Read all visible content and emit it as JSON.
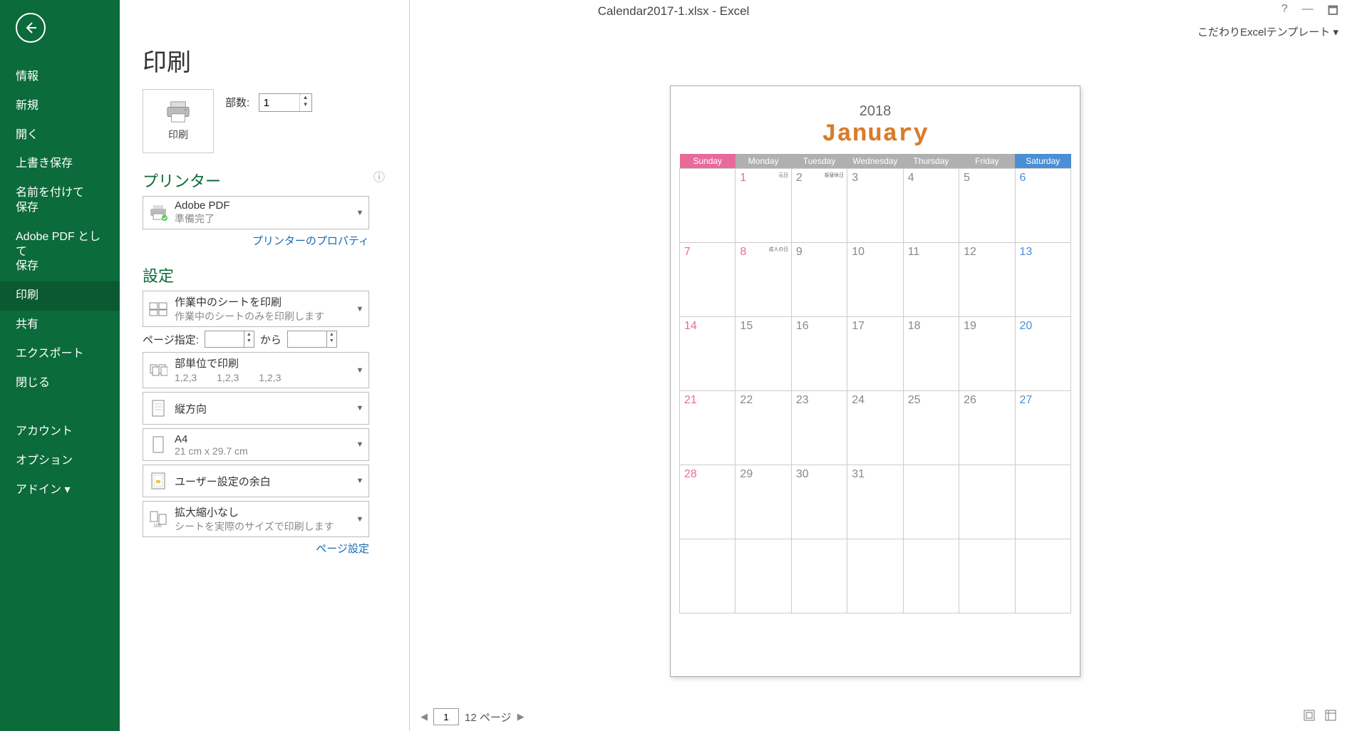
{
  "title": "Calendar2017-1.xlsx - Excel",
  "ribbon_right": "こだわりExcelテンプレート ▾",
  "winctrls": {
    "help": "?",
    "min": "—",
    "restore": "🗖"
  },
  "green_menu": {
    "items": [
      "情報",
      "新規",
      "開く",
      "上書き保存",
      "名前を付けて\n保存",
      "Adobe PDF として\n保存",
      "印刷",
      "共有",
      "エクスポート",
      "閉じる",
      "アカウント",
      "オプション",
      "アドイン ▾"
    ],
    "selected_index": 6
  },
  "mid": {
    "heading": "印刷",
    "print_button": "印刷",
    "copies_label": "部数:",
    "copies_value": "1",
    "printer_heading": "プリンター",
    "printer": {
      "name": "Adobe PDF",
      "status": "準備完了"
    },
    "printer_props_link": "プリンターのプロパティ",
    "settings_heading": "設定",
    "setting_scope": {
      "title": "作業中のシートを印刷",
      "sub": "作業中のシートのみを印刷します"
    },
    "page_range": {
      "label": "ページ指定:",
      "from": "",
      "to_label": "から",
      "to": ""
    },
    "collate": {
      "title": "部単位で印刷",
      "sub": "1,2,3　　1,2,3　　1,2,3"
    },
    "orientation": {
      "title": "縦方向"
    },
    "papersize": {
      "title": "A4",
      "sub": "21 cm x 29.7 cm"
    },
    "margins": {
      "title": "ユーザー設定の余白"
    },
    "scaling": {
      "title": "拡大縮小なし",
      "sub": "シートを実際のサイズで印刷します"
    },
    "page_setup_link": "ページ設定"
  },
  "preview": {
    "page_input": "1",
    "page_total_text": "12 ページ",
    "calendar": {
      "year": "2018",
      "month": "January",
      "day_headers": [
        "Sunday",
        "Monday",
        "Tuesday",
        "Wednesday",
        "Thursday",
        "Friday",
        "Saturday"
      ],
      "weeks": [
        [
          {
            "n": ""
          },
          {
            "n": "1",
            "hol": true,
            "label": "元日"
          },
          {
            "n": "2",
            "label": "振替休日"
          },
          {
            "n": "3"
          },
          {
            "n": "4"
          },
          {
            "n": "5"
          },
          {
            "n": "6"
          }
        ],
        [
          {
            "n": "7"
          },
          {
            "n": "8",
            "hol": true,
            "label": "成人の日"
          },
          {
            "n": "9"
          },
          {
            "n": "10"
          },
          {
            "n": "11"
          },
          {
            "n": "12"
          },
          {
            "n": "13"
          }
        ],
        [
          {
            "n": "14"
          },
          {
            "n": "15"
          },
          {
            "n": "16"
          },
          {
            "n": "17"
          },
          {
            "n": "18"
          },
          {
            "n": "19"
          },
          {
            "n": "20"
          }
        ],
        [
          {
            "n": "21"
          },
          {
            "n": "22"
          },
          {
            "n": "23"
          },
          {
            "n": "24"
          },
          {
            "n": "25"
          },
          {
            "n": "26"
          },
          {
            "n": "27"
          }
        ],
        [
          {
            "n": "28"
          },
          {
            "n": "29"
          },
          {
            "n": "30"
          },
          {
            "n": "31"
          },
          {
            "n": ""
          },
          {
            "n": ""
          },
          {
            "n": ""
          }
        ],
        [
          {
            "n": ""
          },
          {
            "n": ""
          },
          {
            "n": ""
          },
          {
            "n": ""
          },
          {
            "n": ""
          },
          {
            "n": ""
          },
          {
            "n": ""
          }
        ]
      ]
    }
  }
}
